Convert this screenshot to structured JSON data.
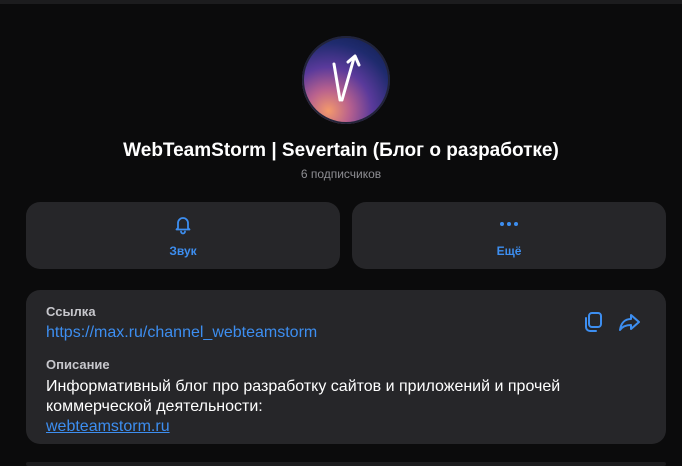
{
  "channel": {
    "title": "WebTeamStorm | Severtain (Блог о разработке)",
    "subscribers": "6 подписчиков"
  },
  "actions": {
    "sound_label": "Звук",
    "more_label": "Ещё"
  },
  "info": {
    "link_label": "Ссылка",
    "link_url": "https://max.ru/channel_webteamstorm",
    "description_label": "Описание",
    "description_text": "Информативный блог про разработку сайтов и приложений и прочей коммерческой деятельности:",
    "description_link": "webteamstorm.ru"
  },
  "icons": {
    "sound": "bell-icon",
    "more": "more-dots-icon",
    "copy": "copy-icon",
    "share": "share-icon"
  },
  "colors": {
    "background": "#0b0b0c",
    "card": "#262629",
    "accent": "#3d8ef0",
    "muted": "#8e8e93"
  }
}
